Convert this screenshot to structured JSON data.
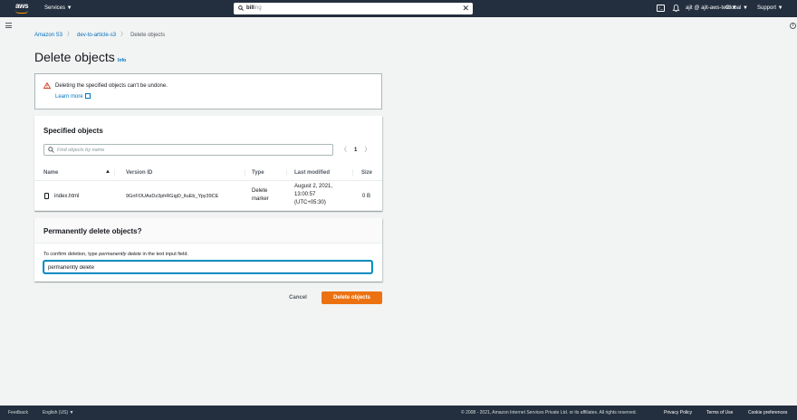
{
  "topnav": {
    "logo": "aws",
    "services_label": "Services ▼",
    "search_value_typed": "bill",
    "search_value_hint": "ing",
    "account_label": "ajit @ ajit-aws-test ▼",
    "region_label": "Global ▼",
    "support_label": "Support ▼"
  },
  "breadcrumb": {
    "items": [
      "Amazon S3",
      "dev-to-article-s3",
      "Delete objects"
    ]
  },
  "page": {
    "title": "Delete objects",
    "info_link": "Info"
  },
  "alert": {
    "message": "Deleting the specified objects can't be undone.",
    "learn_more": "Learn more"
  },
  "specified_objects": {
    "title": "Specified objects",
    "search_placeholder": "Find objects by name",
    "page_number": "1",
    "columns": [
      "Name",
      "Version ID",
      "Type",
      "Last modified",
      "Size"
    ],
    "rows": [
      {
        "name": "index.html",
        "version_id": "9GnFOUAsDz3phRGigD_ltuEb_Ypy39CE",
        "type_line1": "Delete",
        "type_line2": "marker",
        "modified_line1": "August 2, 2021,",
        "modified_line2": "13:00:57",
        "modified_line3": "(UTC+05:30)",
        "size": "0 B"
      }
    ]
  },
  "permanent_delete": {
    "title": "Permanently delete objects?",
    "instruction_prefix": "To confirm deletion, type ",
    "instruction_emphasis": "permanently delete",
    "instruction_suffix": " in the text input field.",
    "input_value": "permanently delete"
  },
  "actions": {
    "cancel_label": "Cancel",
    "delete_label": "Delete objects"
  },
  "footer": {
    "feedback": "Feedback",
    "language": "English (US) ▼",
    "copyright": "© 2008 - 2021, Amazon Internet Services Private Ltd. or its affiliates. All rights reserved.",
    "privacy": "Privacy Policy",
    "terms": "Terms of Use",
    "cookies": "Cookie preferences"
  },
  "colors": {
    "nav_bg": "#232f3e",
    "link": "#0073bb",
    "primary_button": "#ec7211",
    "warning": "#d13212"
  }
}
